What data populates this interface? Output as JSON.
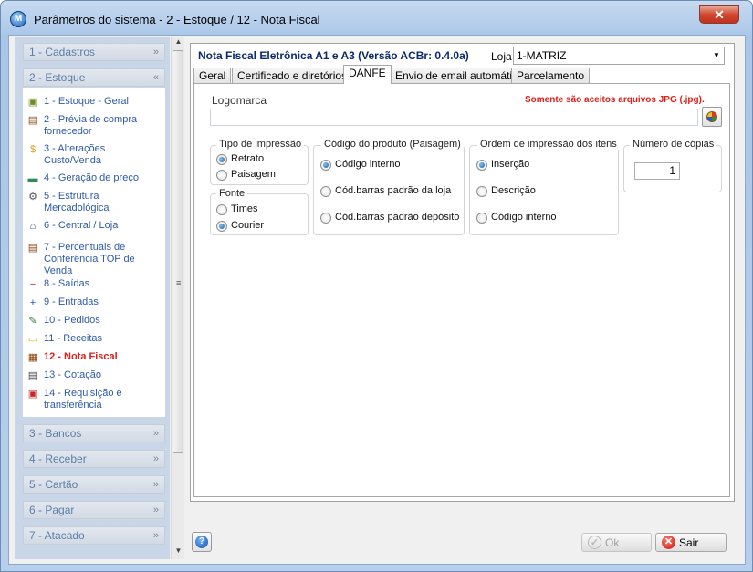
{
  "window": {
    "title": "Parâmetros do sistema - 2 - Estoque / 12 - Nota Fiscal",
    "close_glyph": "✕"
  },
  "sidebar": {
    "groups_top": [
      {
        "label": "1 - Cadastros",
        "chevron": "»"
      },
      {
        "label": "2 - Estoque",
        "chevron": "«"
      }
    ],
    "items": [
      {
        "label": "1 - Estoque - Geral",
        "icon": "stock-icon",
        "glyph": "▣",
        "color": "#6b8e23"
      },
      {
        "label": "2 - Prévia de compra fornecedor",
        "icon": "clipboard-icon",
        "glyph": "▤",
        "color": "#8b4513"
      },
      {
        "label": "3 - Alterações Custo/Venda",
        "icon": "dollar-icon",
        "glyph": "$",
        "color": "#d4a017"
      },
      {
        "label": "4 - Geração de preço",
        "icon": "money-icon",
        "glyph": "▬",
        "color": "#2e8b57"
      },
      {
        "label": "5 - Estrutura Mercadológica",
        "icon": "gears-icon",
        "glyph": "⚙",
        "color": "#555555"
      },
      {
        "label": "6 - Central / Loja",
        "icon": "bank-icon",
        "glyph": "⌂",
        "color": "#1f3f8f"
      },
      {
        "label": "7 - Percentuais de Conferência TOP de Venda",
        "icon": "clipboard-check-icon",
        "glyph": "▤",
        "color": "#8b4513"
      },
      {
        "label": "8 - Saídas",
        "icon": "minus-circle-icon",
        "glyph": "−",
        "color": "#d21f1b"
      },
      {
        "label": "9 - Entradas",
        "icon": "plus-circle-icon",
        "glyph": "+",
        "color": "#1d4fbf"
      },
      {
        "label": "10 - Pedidos",
        "icon": "order-icon",
        "glyph": "✎",
        "color": "#2e7d32"
      },
      {
        "label": "11 - Receitas",
        "icon": "note-icon",
        "glyph": "▭",
        "color": "#d4b106"
      },
      {
        "label": "12 - Nota Fiscal",
        "icon": "invoice-icon",
        "glyph": "▦",
        "color": "#8b3a00"
      },
      {
        "label": "13 - Cotação",
        "icon": "quote-icon",
        "glyph": "▤",
        "color": "#444444"
      },
      {
        "label": "14 - Requisição e transferência",
        "icon": "transfer-icon",
        "glyph": "▣",
        "color": "#c62828"
      }
    ],
    "groups_bottom": [
      {
        "label": "3 - Bancos",
        "chevron": "»"
      },
      {
        "label": "4 - Receber",
        "chevron": "»"
      },
      {
        "label": "5 - Cartão",
        "chevron": "»"
      },
      {
        "label": "6 - Pagar",
        "chevron": "»"
      },
      {
        "label": "7 - Atacado",
        "chevron": "»"
      }
    ],
    "active_index": 11
  },
  "main": {
    "title": "Nota Fiscal Eletrônica A1 e A3 (Versão ACBr: 0.4.0a)",
    "loja_label": "Loja",
    "loja_value": "1-MATRIZ",
    "tabs": [
      {
        "label": "Geral"
      },
      {
        "label": "Certificado e diretórios"
      },
      {
        "label": "DANFE"
      },
      {
        "label": "Envio de email automático"
      },
      {
        "label": "Parcelamento"
      }
    ],
    "active_tab": 2
  },
  "danfe": {
    "logo_label": "Logomarca",
    "logo_warning": "Somente são aceitos arquivos JPG (.jpg).",
    "logo_value": "",
    "tipo_impressao": {
      "title": "Tipo de impressão",
      "options": [
        "Retrato",
        "Paisagem"
      ],
      "selected": 0
    },
    "fonte": {
      "title": "Fonte",
      "options": [
        "Times",
        "Courier"
      ],
      "selected": 1
    },
    "codigo_produto": {
      "title": "Código do produto (Paisagem)",
      "options": [
        "Código interno",
        "Cód.barras padrão da loja",
        "Cód.barras padrão depósito"
      ],
      "selected": 0
    },
    "ordem_impressao": {
      "title": "Ordem de impressão dos itens",
      "options": [
        "Inserção",
        "Descrição",
        "Código interno"
      ],
      "selected": 0
    },
    "copias": {
      "title": "Número de cópias",
      "value": "1"
    }
  },
  "buttons": {
    "help_glyph": "?",
    "ok": {
      "label": "Ok",
      "glyph": "✓"
    },
    "sair": {
      "label": "Sair",
      "glyph": "✕"
    }
  }
}
